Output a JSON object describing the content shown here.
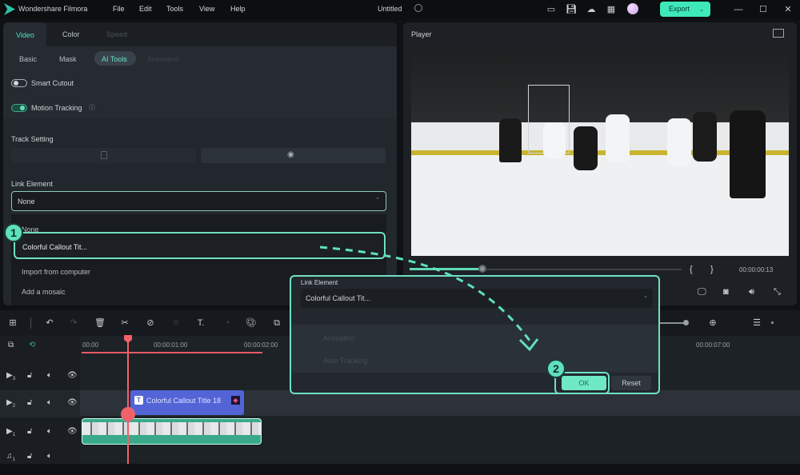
{
  "app": {
    "name": "Wondershare Filmora",
    "project_title": "Untitled"
  },
  "menu": [
    "File",
    "Edit",
    "Tools",
    "View",
    "Help"
  ],
  "topbar": {
    "export_label": "Export",
    "icons": [
      "layout-icon",
      "save-icon",
      "cloud-icon",
      "grid-icon",
      "avatar"
    ]
  },
  "left_panel": {
    "tabs": [
      "Video",
      "Color",
      "Speed"
    ],
    "subtabs": [
      "Basic",
      "Mask",
      "AI Tools",
      "Animation"
    ],
    "smart_cutout": "Smart Cutout",
    "motion_tracking": "Motion Tracking",
    "track_setting_label": "Track Setting",
    "link_element_label": "Link Element",
    "link_element_value": "None",
    "dropdown_options": [
      "None",
      "Colorful Callout Tit...",
      "Import from computer",
      "Add a mosaic"
    ],
    "selected_option": "Colorful Callout Tit..."
  },
  "player": {
    "title": "Player",
    "timecode": "00:00:00:13",
    "progress_fraction": 0.27,
    "bracket_in": "{",
    "bracket_out": "}"
  },
  "dialog": {
    "label": "Link Element",
    "value": "Colorful Callout Tit...",
    "ok_label": "OK",
    "reset_label": "Reset",
    "faded_rows": [
      "Animation",
      "Auto Tracking"
    ]
  },
  "timeline": {
    "ruler": [
      "00:00",
      "00:00:01:00",
      "00:00:02:00",
      "00:00:07:00"
    ],
    "tracks": [
      "3",
      "2",
      "1",
      "1"
    ],
    "title_clip": "Colorful Callout Title 18"
  },
  "annotations": {
    "step1": "1",
    "step2": "2"
  },
  "colors": {
    "accent": "#5fe0bd",
    "playhead": "#f0626a",
    "title_clip": "#5264d6",
    "video_clip": "#3aa98b"
  }
}
